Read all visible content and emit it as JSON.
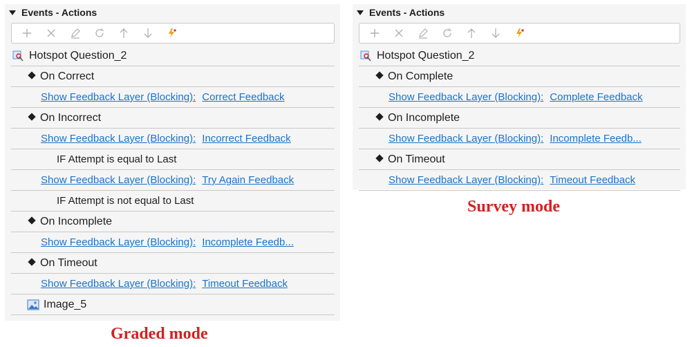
{
  "graded": {
    "header": "Events - Actions",
    "object": "Hotspot Question_2",
    "events": [
      {
        "label": "On Correct",
        "action": "Show Feedback Layer (Blocking):",
        "target": "Correct Feedback"
      },
      {
        "label": "On Incorrect",
        "action": "Show Feedback Layer (Blocking):",
        "target": "Incorrect Feedback"
      },
      {
        "condition": "IF Attempt is equal to Last",
        "action": "Show Feedback Layer (Blocking):",
        "target": "Try Again Feedback"
      },
      {
        "condition": "IF Attempt is not equal to Last"
      },
      {
        "label": "On Incomplete",
        "action": "Show Feedback Layer (Blocking):",
        "target": "Incomplete Feedb..."
      },
      {
        "label": "On Timeout",
        "action": "Show Feedback Layer (Blocking):",
        "target": "Timeout Feedback"
      }
    ],
    "child": "Image_5",
    "caption": "Graded mode"
  },
  "survey": {
    "header": "Events - Actions",
    "object": "Hotspot Question_2",
    "events": [
      {
        "label": "On Complete",
        "action": "Show Feedback Layer (Blocking):",
        "target": "Complete Feedback"
      },
      {
        "label": "On Incomplete",
        "action": "Show Feedback Layer (Blocking):",
        "target": "Incomplete Feedb..."
      },
      {
        "label": "On Timeout",
        "action": "Show Feedback Layer (Blocking):",
        "target": "Timeout Feedback"
      }
    ],
    "caption": "Survey mode"
  },
  "toolbar_icons": [
    "add-icon",
    "delete-icon",
    "edit-icon",
    "refresh-icon",
    "move-up-icon",
    "move-down-icon",
    "new-action-icon"
  ],
  "colors": {
    "link": "#1a73c8",
    "caption": "#d42020",
    "panel": "#f5f5f5"
  }
}
